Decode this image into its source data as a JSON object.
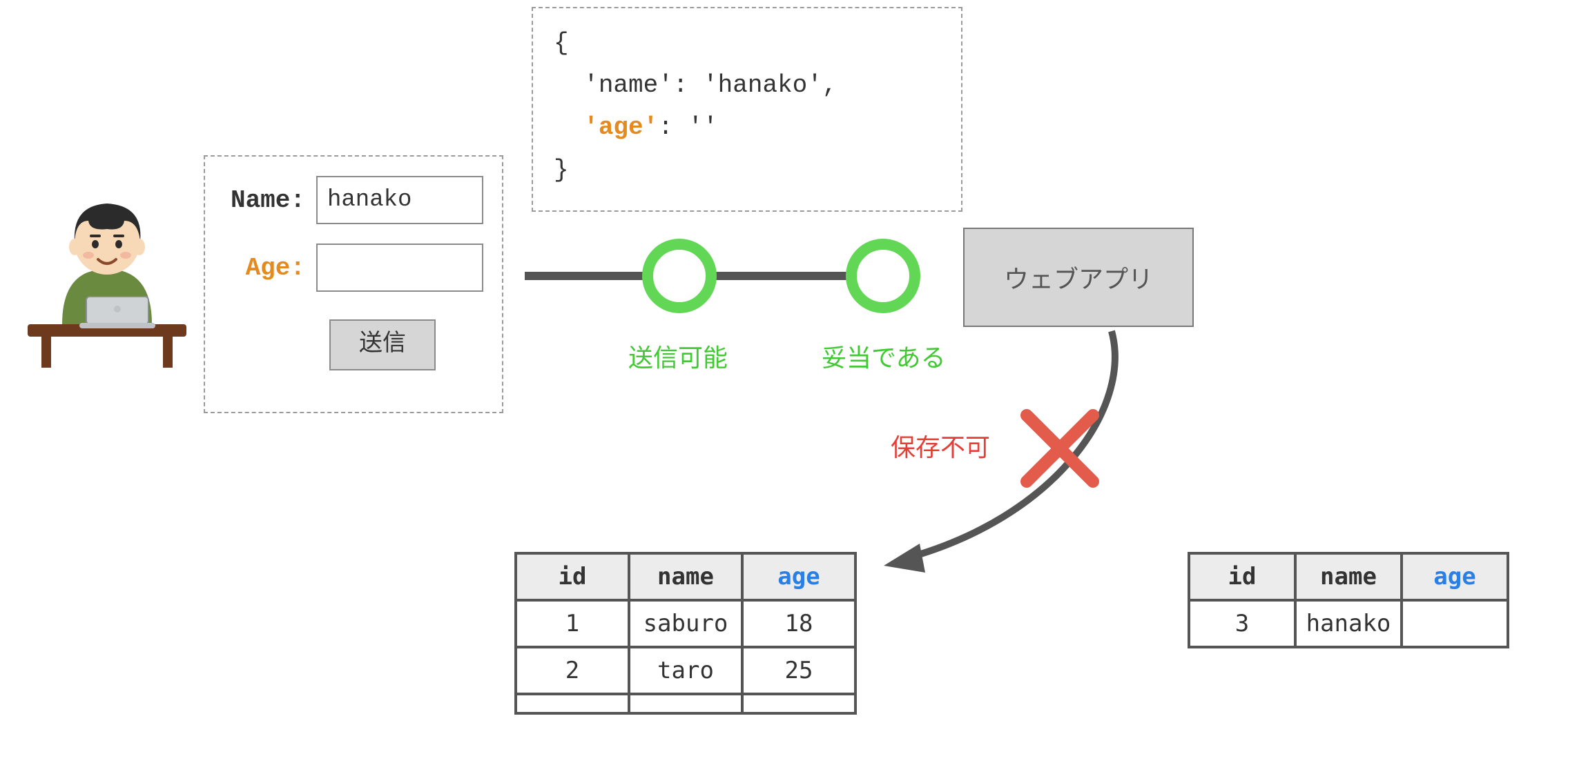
{
  "form": {
    "name_label": "Name:",
    "age_label": "Age:",
    "name_value": "hanako",
    "age_value": "",
    "submit_label": "送信"
  },
  "json_payload": {
    "open": "{",
    "line1_key": "'name'",
    "line1_sep": ": ",
    "line1_val": "'hanako'",
    "line1_comma": ",",
    "line2_key": "'age'",
    "line2_sep": ": ",
    "line2_val": "''",
    "close": "}"
  },
  "flow": {
    "sendable_label": "送信可能",
    "valid_label": "妥当である",
    "webapp_label": "ウェブアプリ",
    "save_error_label": "保存不可"
  },
  "main_table": {
    "headers": {
      "id": "id",
      "name": "name",
      "age": "age"
    },
    "rows": [
      {
        "id": "1",
        "name": "saburo",
        "age": "18"
      },
      {
        "id": "2",
        "name": "taro",
        "age": "25"
      },
      {
        "id": "",
        "name": "",
        "age": ""
      }
    ]
  },
  "pending_table": {
    "headers": {
      "id": "id",
      "name": "name",
      "age": "age"
    },
    "rows": [
      {
        "id": "3",
        "name": "hanako",
        "age": ""
      }
    ]
  }
}
